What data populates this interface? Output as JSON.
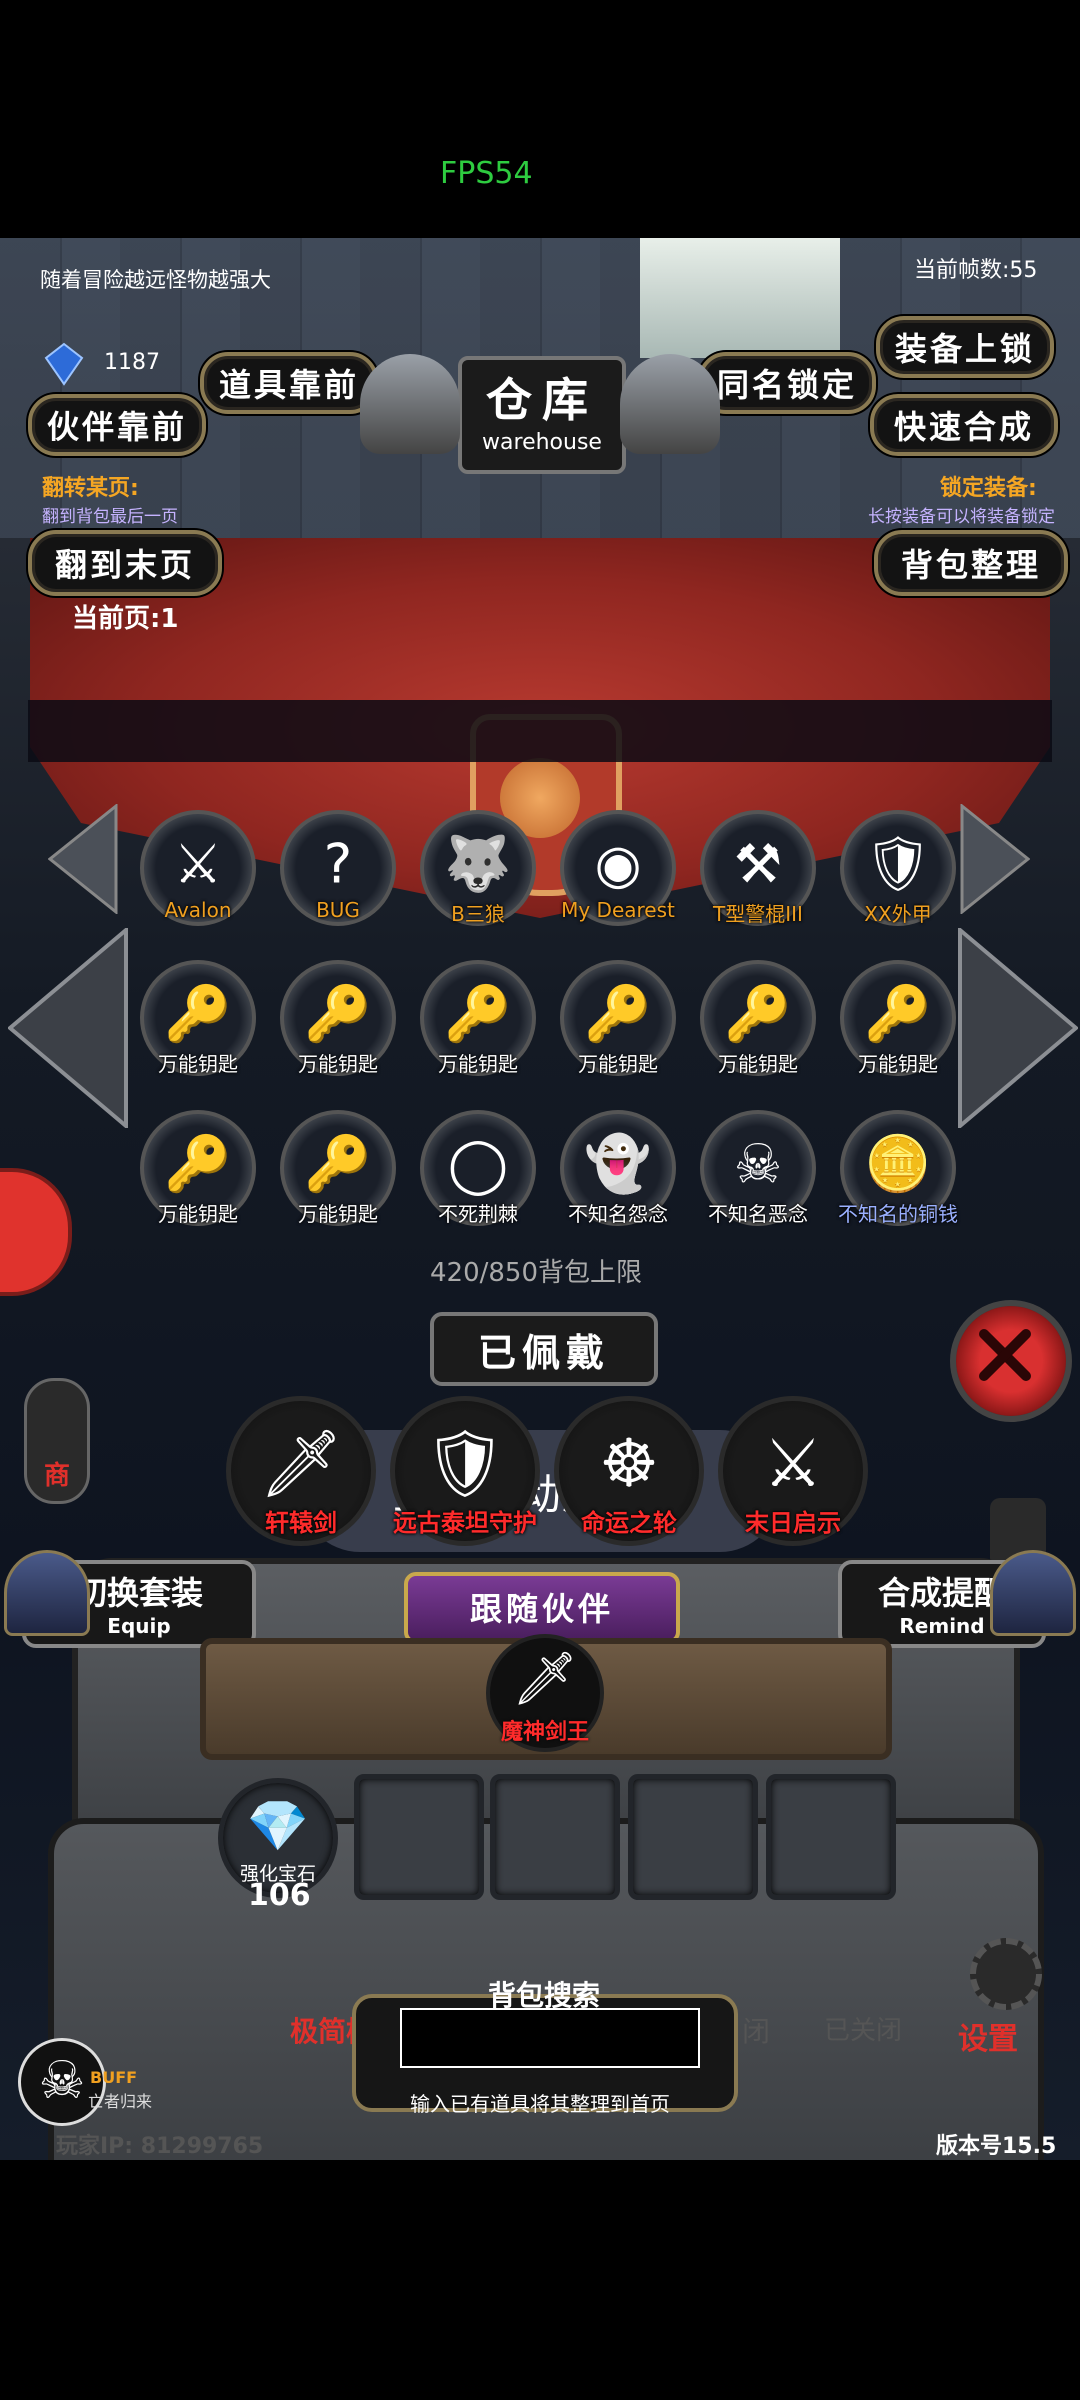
{
  "fps": "FPS54",
  "header": {
    "tip": "随着冒险越远怪物越强大",
    "frame_count": "当前帧数:55",
    "crystal_count": "1187"
  },
  "buttons": {
    "items_front": "道具靠前",
    "partner_front": "伙伴靠前",
    "same_name_lock": "同名锁定",
    "equip_lock": "装备上锁",
    "quick_merge": "快速合成",
    "to_last_page": "翻到末页",
    "bag_sort": "背包整理"
  },
  "warehouse": {
    "title": "仓库",
    "subtitle": "warehouse"
  },
  "info": {
    "flip_title": "翻转某页:",
    "flip_desc": "翻到背包最后一页",
    "lock_title": "锁定装备:",
    "lock_desc": "长按装备可以将装备锁定",
    "current_page": "当前页:1"
  },
  "grid": [
    {
      "label": "Avalon",
      "color": "#f0a020",
      "icon": "⚔"
    },
    {
      "label": "BUG",
      "color": "#f0a020",
      "icon": "?"
    },
    {
      "label": "B三狼",
      "color": "#f0a020",
      "icon": "🐺"
    },
    {
      "label": "My Dearest",
      "color": "#f0a020",
      "icon": "◉"
    },
    {
      "label": "T型警棍III",
      "color": "#f0a020",
      "icon": "⚒"
    },
    {
      "label": "XX外甲",
      "color": "#f0a020",
      "icon": "🛡"
    },
    {
      "label": "万能钥匙",
      "color": "#ffffff",
      "icon": "🔑"
    },
    {
      "label": "万能钥匙",
      "color": "#ffffff",
      "icon": "🔑"
    },
    {
      "label": "万能钥匙",
      "color": "#ffffff",
      "icon": "🔑"
    },
    {
      "label": "万能钥匙",
      "color": "#ffffff",
      "icon": "🔑"
    },
    {
      "label": "万能钥匙",
      "color": "#ffffff",
      "icon": "🔑"
    },
    {
      "label": "万能钥匙",
      "color": "#ffffff",
      "icon": "🔑"
    },
    {
      "label": "万能钥匙",
      "color": "#ffffff",
      "icon": "🔑"
    },
    {
      "label": "万能钥匙",
      "color": "#ffffff",
      "icon": "🔑"
    },
    {
      "label": "不死荆棘",
      "color": "#ffffff",
      "icon": "◯"
    },
    {
      "label": "不知名怨念",
      "color": "#ffffff",
      "icon": "👻"
    },
    {
      "label": "不知名恶念",
      "color": "#ffffff",
      "icon": "☠"
    },
    {
      "label": "不知名的铜钱",
      "color": "#9ab0ff",
      "icon": "🪙"
    }
  ],
  "toast": "正在启动游戏…",
  "capacity": "420/850背包上限",
  "equipped": {
    "title": "已佩戴",
    "items": [
      {
        "label": "轩辕剑",
        "icon": "🗡"
      },
      {
        "label": "远古泰坦守护",
        "icon": "🛡"
      },
      {
        "label": "命运之轮",
        "icon": "☸"
      },
      {
        "label": "末日启示",
        "icon": "⚔"
      }
    ]
  },
  "switch_set": {
    "label": "切换套装",
    "sub": "Equip"
  },
  "merge_remind": {
    "label": "合成提醒",
    "sub": "Remind"
  },
  "partner": {
    "title": "跟随伙伴",
    "name": "魔神剑王"
  },
  "gem": {
    "label": "强化宝石",
    "count": "106"
  },
  "side": {
    "shop": "商",
    "simple": "极简模",
    "closed1": "闭",
    "closed2": "已关闭",
    "settings": "设置"
  },
  "search": {
    "title": "背包搜索",
    "hint": "输入已有道具将其整理到首页",
    "value": ""
  },
  "buff": {
    "label": "BUFF",
    "sub": "亡者归来"
  },
  "footer": {
    "ip": "玩家IP: 81299765",
    "version": "版本号15.5"
  }
}
